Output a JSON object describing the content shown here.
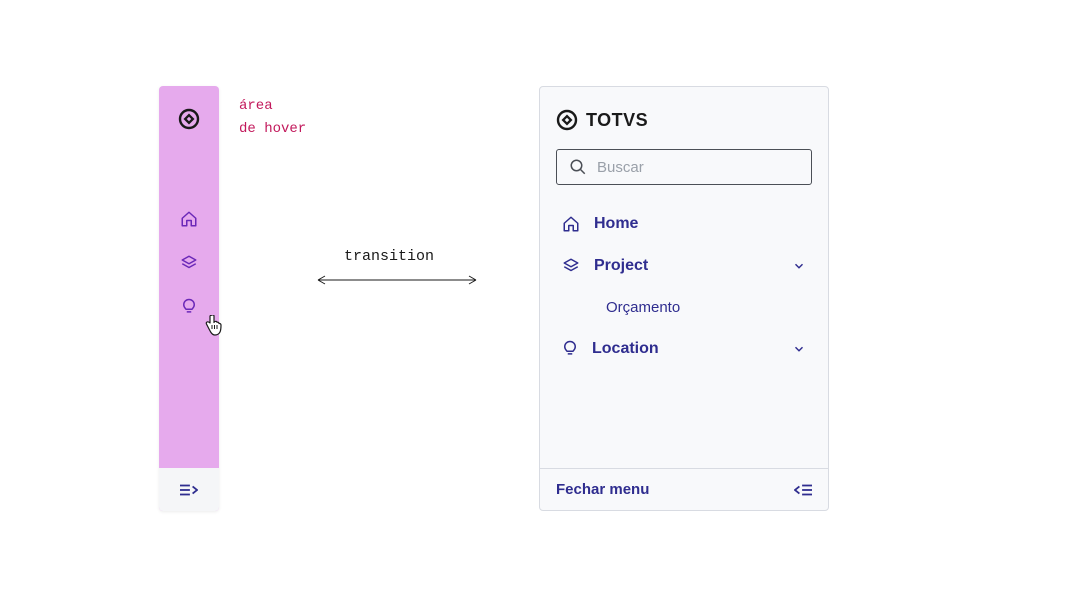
{
  "annotations": {
    "hover_area_line1": "área",
    "hover_area_line2": "de hover",
    "transition": "transition"
  },
  "brand": {
    "name": "TOTVS"
  },
  "search": {
    "placeholder": "Buscar"
  },
  "nav": {
    "home": "Home",
    "project": "Project",
    "project_sub": "Orçamento",
    "location": "Location"
  },
  "footer": {
    "close_menu": "Fechar menu"
  }
}
